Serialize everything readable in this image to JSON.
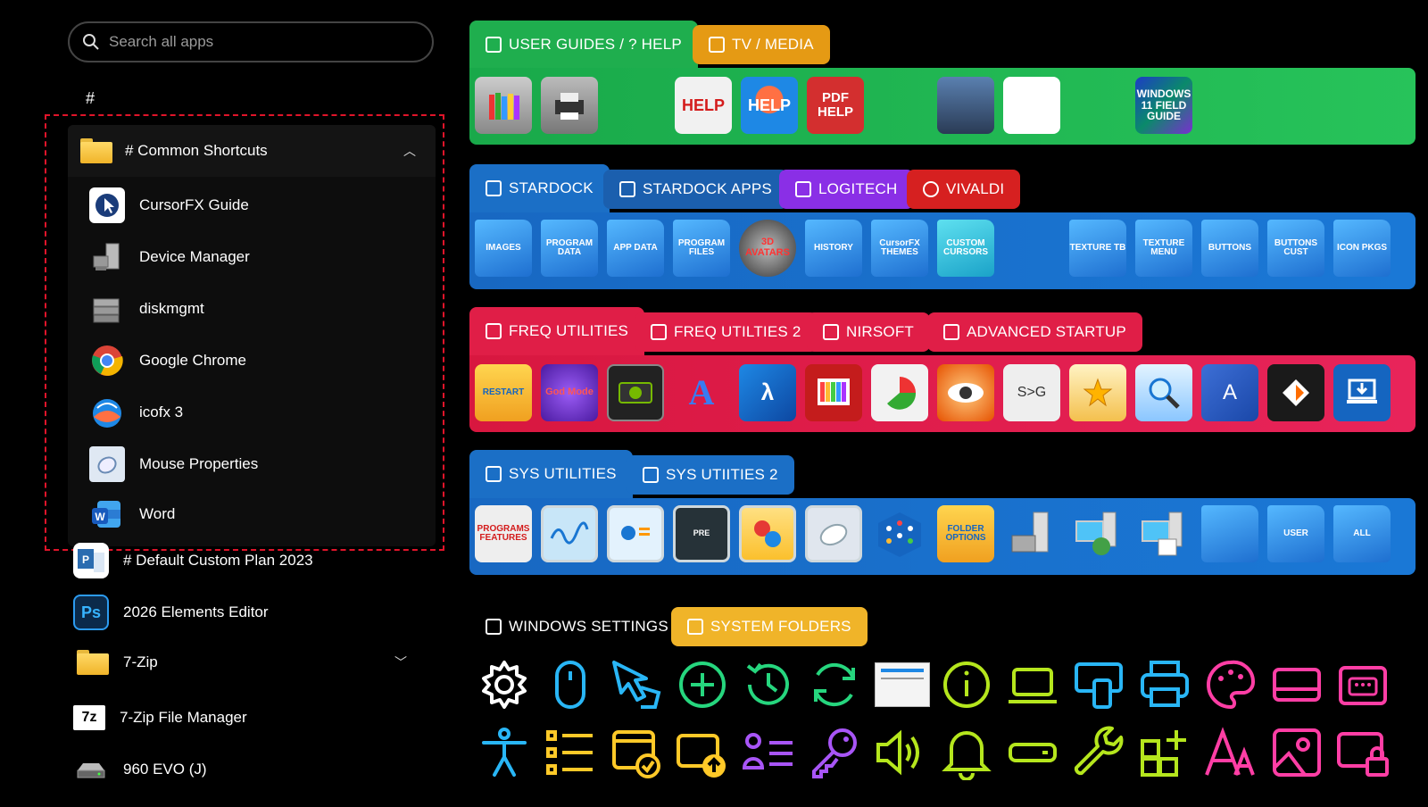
{
  "search": {
    "placeholder": "Search all apps"
  },
  "left": {
    "hash_header": "#",
    "group": {
      "label": "# Common Shortcuts",
      "items": [
        {
          "name": "CursorFX Guide",
          "icon": "cursorfx-icon"
        },
        {
          "name": "Device Manager",
          "icon": "device-manager-icon"
        },
        {
          "name": "diskmgmt",
          "icon": "disk-icon"
        },
        {
          "name": "Google Chrome",
          "icon": "chrome-icon"
        },
        {
          "name": "icofx 3",
          "icon": "icofx-icon"
        },
        {
          "name": "Mouse Properties",
          "icon": "mouse-icon"
        },
        {
          "name": "Word",
          "icon": "word-icon"
        }
      ]
    },
    "apps": [
      {
        "name": "# Default Custom Plan 2023",
        "icon": "publisher-icon"
      },
      {
        "name": "2026 Elements Editor",
        "icon": "photoshop-icon"
      },
      {
        "name": "7-Zip",
        "icon": "folder-icon"
      },
      {
        "name": "7-Zip File Manager",
        "icon": "7zip-icon"
      },
      {
        "name": "960 EVO (J)",
        "icon": "drive-icon"
      }
    ]
  },
  "sections": [
    {
      "tabs": [
        "USER GUIDES / ? HELP",
        "TV / MEDIA"
      ],
      "tiles": [
        "library-icon",
        "printer-icon",
        "HELP",
        "HELP",
        "PDF HELP",
        "home-designer-icon",
        "reference-manual-icon",
        "WINDOWS 11 FIELD GUIDE"
      ]
    },
    {
      "tabs": [
        "STARDOCK",
        "STARDOCK APPS",
        "LOGITECH",
        "VIVALDI"
      ],
      "tiles": [
        "IMAGES",
        "PROGRAM DATA",
        "APP DATA",
        "PROGRAM FILES",
        "3D AVATARS",
        "HISTORY",
        "CursorFX THEMES",
        "CUSTOM CURSORS",
        "TEXTURE TB",
        "TEXTURE MENU",
        "BUTTONS",
        "BUTTONS CUST",
        "ICON PKGS"
      ]
    },
    {
      "tabs": [
        "FREQ UTILITIES",
        "FREQ UTILTIES 2",
        "NIRSOFT",
        "ADVANCED STARTUP"
      ],
      "tiles": [
        "RESTART",
        "God Mode",
        "gpu-icon",
        "font-icon",
        "lambda-icon",
        "color-bars-icon",
        "pie-icon",
        "eye-icon",
        "S>G",
        "star-icon",
        "magnifier-icon",
        "A",
        "diamond-icon",
        "download-icon"
      ]
    },
    {
      "tabs": [
        "SYS UTILITIES",
        "SYS UTIITIES 2"
      ],
      "tiles": [
        "PROGRAMS FEATURES",
        "monitor-wave-icon",
        "presentation-icon",
        "PRE",
        "error-info-icon",
        "mouse-tile-icon",
        "cube-icon",
        "FOLDER OPTIONS",
        "toolbox-icon",
        "backup-icon",
        "checklist-icon",
        "home-folder-icon",
        "USER",
        "ALL"
      ]
    }
  ],
  "settings_tabs": [
    "WINDOWS SETTINGS",
    "SYSTEM FOLDERS"
  ],
  "settings_icons_row1": [
    "gear-icon",
    "mouse-icon",
    "pointer-icon",
    "plus-circle-icon",
    "history-icon",
    "refresh-icon",
    "windows11-icon",
    "info-icon",
    "laptop-icon",
    "remote-icon",
    "printer-icon",
    "palette-icon",
    "tablet-icon",
    "keyboard-icon"
  ],
  "settings_icons_row2": [
    "accessibility-icon",
    "list-icon",
    "calendar-check-icon",
    "upload-icon",
    "people-list-icon",
    "key-icon",
    "speaker-icon",
    "bell-icon",
    "bar-icon",
    "wrench-icon",
    "apps-add-icon",
    "font-size-icon",
    "image-icon",
    "lock-screen-icon"
  ],
  "colors": {
    "green": "#1ec04e",
    "blue": "#1570c9",
    "red": "#e01e47",
    "purple": "#8a2fe6",
    "orange": "#e59a14",
    "vivaldi": "#d62020"
  }
}
